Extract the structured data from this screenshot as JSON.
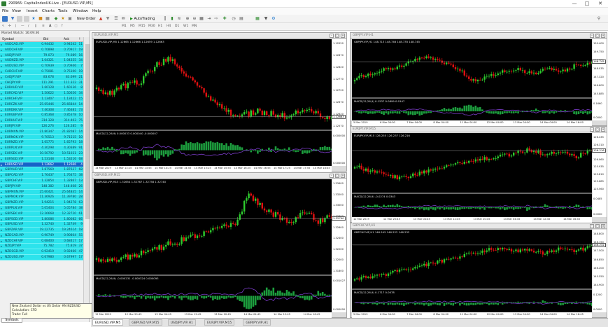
{
  "window": {
    "title": "290966: CapitalIndexUK-Live - [EURUSD.VIP,M5]"
  },
  "menu": [
    "File",
    "View",
    "Insert",
    "Charts",
    "Tools",
    "Window",
    "Help"
  ],
  "toolbar": {
    "new_order": "New Order",
    "auto_trading": "AutoTrading",
    "timeframes": [
      "M1",
      "M5",
      "M15",
      "M30",
      "H1",
      "H4",
      "D1",
      "W1",
      "MN"
    ]
  },
  "market_watch": {
    "title": "Market Watch: 16:09:36",
    "headers": {
      "symbol": "Symbol",
      "bid": "Bid",
      "ask": "Ask",
      "spread": "!"
    },
    "rows": [
      {
        "symbol": "AUDCAD.VIP",
        "bid": "0.94432",
        "ask": "0.94542",
        "spread": "11"
      },
      {
        "symbol": "AUDCHF.VIP",
        "bid": "0.70898",
        "ask": "0.70917",
        "spread": "19"
      },
      {
        "symbol": "AUDJPY.VIP",
        "bid": "79.073",
        "ask": "79.089",
        "spread": "16"
      },
      {
        "symbol": "AUDNZD.VIP",
        "bid": "1.04321",
        "ask": "1.04355",
        "spread": "34"
      },
      {
        "symbol": "AUDUSD.VIP",
        "bid": "0.70939",
        "ask": "0.70946",
        "spread": "7"
      },
      {
        "symbol": "CADCHF.VIP",
        "bid": "0.75081",
        "ask": "0.75100",
        "spread": "19"
      },
      {
        "symbol": "CADJPY.VIP",
        "bid": "83.678",
        "ask": "83.699",
        "spread": "21"
      },
      {
        "symbol": "CHFJPY.VIP",
        "bid": "111.291",
        "ask": "111.322",
        "spread": "31"
      },
      {
        "symbol": "EURAUD.VIP",
        "bid": "1.60128",
        "ask": "1.60136",
        "spread": "8"
      },
      {
        "symbol": "EURCAD.VIP",
        "bid": "1.50622",
        "ask": "1.50656",
        "spread": "34"
      },
      {
        "symbol": "EURCHF.VIP",
        "bid": "1.13407",
        "ask": "1.13422",
        "spread": "15"
      },
      {
        "symbol": "EURCZK.VIP",
        "bid": "25.65446",
        "ask": "25.66844",
        "spread": "14"
      },
      {
        "symbol": "EURDKK.VIP",
        "bid": "7.46308",
        "ask": "7.46381",
        "spread": "73"
      },
      {
        "symbol": "EURGBP.VIP",
        "bid": "0.85368",
        "ask": "0.85378",
        "spread": "10"
      },
      {
        "symbol": "EURHUF.VIP",
        "bid": "314.328",
        "ask": "314.403",
        "spread": "75"
      },
      {
        "symbol": "EURJPY.VIP",
        "bid": "126.276",
        "ask": "126.285",
        "spread": "9"
      },
      {
        "symbol": "EURMXN.VIP",
        "bid": "21.80347",
        "ask": "21.82087",
        "spread": "14"
      },
      {
        "symbol": "EURNOK.VIP",
        "bid": "9.70513",
        "ask": "9.71515",
        "spread": "10"
      },
      {
        "symbol": "EURNZD.VIP",
        "bid": "1.65775",
        "ask": "1.65793",
        "spread": "18"
      },
      {
        "symbol": "EURPLN.VIP",
        "bid": "4.30298",
        "ask": "4.30389",
        "spread": "91"
      },
      {
        "symbol": "EURSEK.VIP",
        "bid": "10.50792",
        "ask": "10.51031",
        "spread": "23"
      },
      {
        "symbol": "EURSGD.VIP",
        "bid": "1.53148",
        "ask": "1.53216",
        "spread": "68"
      },
      {
        "symbol": "EURUSD.VIP",
        "bid": "1.12662",
        "ask": "1.12666",
        "spread": "4"
      },
      {
        "symbol": "GBPAUD.VIP",
        "bid": "1.87569",
        "ask": "1.87637",
        "spread": "68"
      },
      {
        "symbol": "GBPCAD.VIP",
        "bid": "1.76437",
        "ask": "1.76475",
        "spread": "38"
      },
      {
        "symbol": "GBPCHF.VIP",
        "bid": "1.32854",
        "ask": "1.32867",
        "spread": "13"
      },
      {
        "symbol": "GBPJPY.VIP",
        "bid": "148.382",
        "ask": "148.408",
        "spread": "26"
      },
      {
        "symbol": "GBPMXN.VIP",
        "bid": "25.60421",
        "ask": "25.64835",
        "spread": "14"
      },
      {
        "symbol": "GBPNOK.VIP",
        "bid": "11.36926",
        "ask": "11.39780",
        "spread": "28"
      },
      {
        "symbol": "GBPNZD.VIP",
        "bid": "1.94215",
        "ask": "1.94278",
        "spread": "63"
      },
      {
        "symbol": "GBPPLN.VIP",
        "bid": "5.05404",
        "ask": "5.05784",
        "spread": "38"
      },
      {
        "symbol": "GBPSEK.VIP",
        "bid": "12.26668",
        "ask": "12.32720",
        "spread": "61"
      },
      {
        "symbol": "GBPSGD.VIP",
        "bid": "1.80086",
        "ask": "1.80082",
        "spread": "66"
      },
      {
        "symbol": "GBPUSD.VIP",
        "bid": "1.32740",
        "ask": "1.32749",
        "spread": "9"
      },
      {
        "symbol": "GBPZAR.VIP",
        "bid": "19.22735",
        "ask": "19.24614",
        "spread": "18"
      },
      {
        "symbol": "NZDCAD.VIP",
        "bid": "0.90749",
        "ask": "0.90804",
        "spread": "55"
      },
      {
        "symbol": "NZDCHF.VIP",
        "bid": "0.68400",
        "ask": "0.68417",
        "spread": "17"
      },
      {
        "symbol": "NZDJPY.VIP",
        "bid": "75.782",
        "ask": "75.819",
        "spread": "37"
      },
      {
        "symbol": "NZDSGD.VIP",
        "bid": "0.92419",
        "ask": "0.92466",
        "spread": "47"
      },
      {
        "symbol": "NZDUSD.VIP",
        "bid": "0.67980",
        "ask": "0.67997",
        "spread": "17"
      }
    ],
    "selected_index": 22,
    "tooltip_lines": [
      "New Zealand Dollar vs US Dollar #N NZDUSD",
      "Calculation: CFD",
      "Trade: Full"
    ],
    "tab": "Symbols"
  },
  "charts": [
    {
      "id": "eurusd",
      "window_title": "EURUSD.VIP,M5",
      "ohlc": "EURUSD.VIP,M5 1.12665 1.12666 1.12659 1.12663",
      "indicator": "MACD(12,26,9) 0.000033 0.000040 -0.000007",
      "y_ticks": [
        "1.12920",
        "1.12870",
        "1.12820",
        "1.12770",
        "1.12720",
        "1.12670",
        "1.12620",
        "1.12570"
      ],
      "macd_ticks": [
        "0.000000",
        "0.000000"
      ],
      "x_ticks": [
        "14 Mar 2019",
        "14 Mar 13:25",
        "14 Mar 13:55",
        "14 Mar 14:25",
        "14 Mar 14:55",
        "14 Mar 15:25",
        "14 Mar 15:55",
        "14 Mar 16:25",
        "14 Mar 16:55",
        "14 Mar 17:25",
        "14 Mar 17:55",
        "14 Mar 18:45"
      ],
      "price_label": "1.12663"
    },
    {
      "id": "gbpusd",
      "window_title": "GBPUSD.VIP,M15",
      "ohlc": "GBPUSD.VIP,M15 1.32654 1.32767 1.32758 1.32740",
      "indicator": "MACD(12,26,9) -0.000231 -0.000324 0.000093",
      "y_ticks": [
        "1.33400",
        "1.33200",
        "1.33000",
        "1.32800",
        "1.32600",
        "1.32400",
        "1.32200",
        "1.32000",
        "1.31800"
      ],
      "macd_ticks": [
        "0.001027",
        "0.000000"
      ],
      "x_ticks": [
        "12 Mar 2019",
        "12 Mar 20:45",
        "13 Mar 04:45",
        "13 Mar 12:45",
        "13 Mar 20:45",
        "14 Mar 04:45",
        "14 Mar 12:45",
        "14 Mar 16:45"
      ],
      "price_label": "1.32740"
    },
    {
      "id": "gbpjpy",
      "window_title": "GBPJPY.VIP,H1",
      "ohlc": "GBPJPY.VIP,H1 148.713 148.746 148.735 148.745",
      "indicator": "MACD(12,26,9) 0.1537 0.0899 0.0147",
      "y_ticks": [
        "150.400",
        "149.750",
        "148.750",
        "148.035",
        "147.320",
        "146.600",
        "145.885"
      ],
      "macd_ticks": [
        "0.1660",
        "0.0000"
      ],
      "x_ticks": [
        "5 Mar 2019",
        "6 Mar 04:00",
        "7 Mar 04:00",
        "8 Mar 04:00",
        "11 Mar 04:00",
        "12 Mar 04:00",
        "13 Mar 04:00",
        "14 Mar 04:00",
        "14 Mar 16:00"
      ],
      "price_label": "148.745"
    },
    {
      "id": "eurjpy",
      "window_title": "EURJPY.VIP,M15",
      "ohlc": "EURJPY.VIP,M15 126.255 126.237 126.216",
      "indicator": "MACD(12,26,9) -0.0274 0.0343",
      "y_ticks": [
        "126.435",
        "126.310",
        "126.185",
        "126.060",
        "125.935",
        "125.810",
        "125.685",
        "125.560"
      ],
      "macd_ticks": [
        "0.0485",
        "0.0000"
      ],
      "x_ticks": [
        "12 Mar 2019",
        "12 Mar 20:45",
        "13 Mar 04:45",
        "13 Mar 12:45",
        "13 Mar 20:45",
        "14 Mar 04:45",
        "14 Mar 12:45",
        "14 Mar 16:45"
      ],
      "price_label": "126.216"
    },
    {
      "id": "gbpchf",
      "window_title": "GBPCHF.VIP,H1",
      "ohlc": "GBPCHF.VIP,H1 146.245 146.222 146.232",
      "indicator": "MACD(12,26,9) 0.1717 0.0078",
      "y_ticks": [
        "148.800",
        "148.150",
        "147.500",
        "146.850",
        "146.200",
        "145.550",
        "144.900"
      ],
      "macd_ticks": [
        "0.1200",
        "0.0000"
      ],
      "x_ticks": [
        "5 Mar 2019",
        "6 Mar 04:00",
        "7 Mar 04:00",
        "8 Mar 04:00",
        "11 Mar 04:00",
        "12 Mar 04:00",
        "13 Mar 04:00",
        "14 Mar 04:00",
        "14 Mar 16:45"
      ],
      "price_label": "146.232"
    }
  ],
  "chart_tabs": [
    "EURUSD.VIP,M5",
    "GBPUSD.VIP,M15",
    "USDJPY.VIP,H1",
    "EURJPY.VIP,M15",
    "GBPJPY.VIP,H1"
  ],
  "active_tab": 0,
  "colors": {
    "bull": "#2ecc2e",
    "bear": "#e01010",
    "background": "#000000",
    "watch_row": "#2ce3ec",
    "watch_selected": "#1662c8",
    "macd_hist": "#1d9e3e",
    "signal_line": "#7a3cc8"
  }
}
